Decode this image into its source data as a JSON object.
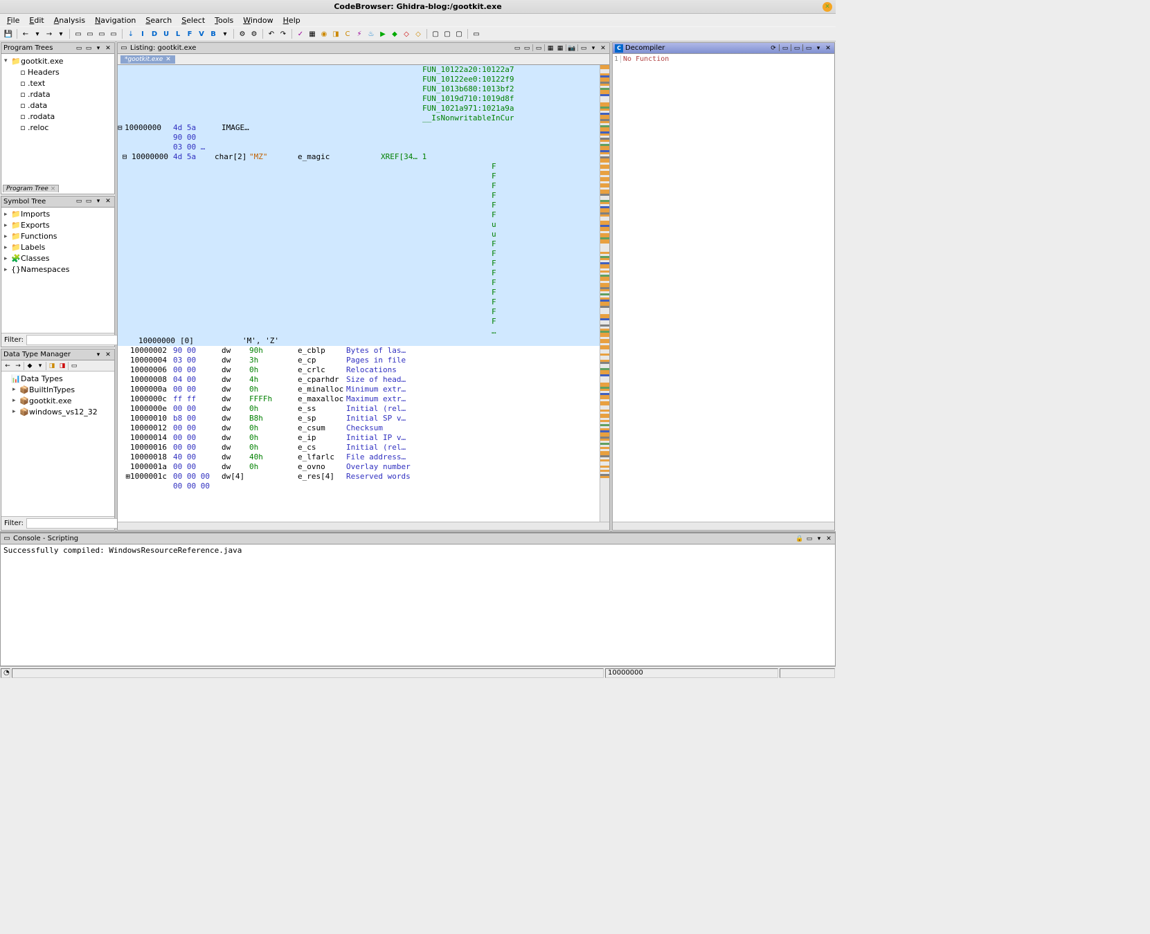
{
  "window": {
    "title": "CodeBrowser: Ghidra-blog:/gootkit.exe"
  },
  "menu": [
    "File",
    "Edit",
    "Analysis",
    "Navigation",
    "Search",
    "Select",
    "Tools",
    "Window",
    "Help"
  ],
  "panels": {
    "program_trees": {
      "title": "Program Trees",
      "root": "gootkit.exe",
      "sections": [
        "Headers",
        ".text",
        ".rdata",
        ".data",
        ".rodata",
        ".reloc"
      ],
      "tab": "Program Tree"
    },
    "symbol_tree": {
      "title": "Symbol Tree",
      "items": [
        "Imports",
        "Exports",
        "Functions",
        "Labels",
        "Classes",
        "Namespaces"
      ],
      "filter_label": "Filter:"
    },
    "dtm": {
      "title": "Data Type Manager",
      "root": "Data Types",
      "items": [
        "BuiltInTypes",
        "gootkit.exe",
        "windows_vs12_32"
      ],
      "filter_label": "Filter:"
    },
    "listing": {
      "title": "Listing: gootkit.exe",
      "tab": "*gootkit.exe",
      "xref_funcs": [
        "FUN_10122a20:10122a7",
        "FUN_10122ee0:10122f9",
        "FUN_1013b680:1013bf2",
        "FUN_1019d710:1019d8f",
        "FUN_1021a971:1021a9a",
        "__IsNonwritableInCur"
      ],
      "header_rows": [
        {
          "addr": "10000000",
          "bytes": "4d 5a",
          "label": "IMAGE…"
        },
        {
          "addr": "",
          "bytes": "90 00",
          "label": ""
        },
        {
          "addr": "",
          "bytes": "03 00 …",
          "label": ""
        }
      ],
      "magic": {
        "addr": "10000000",
        "bytes": "4d 5a",
        "type": "char[2]",
        "val": "\"MZ\"",
        "field": "e_magic",
        "xref": "XREF[34… 1"
      },
      "xref_letters": [
        "F",
        "F",
        "F",
        "F",
        "F",
        "F",
        "u",
        "u",
        "F",
        "F",
        "F",
        "F",
        "F",
        "F",
        "F",
        "F",
        "F",
        "…"
      ],
      "array_row": {
        "addr": "10000000",
        "idx": "[0]",
        "chars": "'M', 'Z'"
      },
      "fields": [
        {
          "addr": "10000002",
          "b": "90 00",
          "t": "dw",
          "v": "90h",
          "f": "e_cblp",
          "c": "Bytes of las…"
        },
        {
          "addr": "10000004",
          "b": "03 00",
          "t": "dw",
          "v": "3h",
          "f": "e_cp",
          "c": "Pages in file"
        },
        {
          "addr": "10000006",
          "b": "00 00",
          "t": "dw",
          "v": "0h",
          "f": "e_crlc",
          "c": "Relocations"
        },
        {
          "addr": "10000008",
          "b": "04 00",
          "t": "dw",
          "v": "4h",
          "f": "e_cparhdr",
          "c": "Size of head…"
        },
        {
          "addr": "1000000a",
          "b": "00 00",
          "t": "dw",
          "v": "0h",
          "f": "e_minalloc",
          "c": "Minimum extr…"
        },
        {
          "addr": "1000000c",
          "b": "ff ff",
          "t": "dw",
          "v": "FFFFh",
          "f": "e_maxalloc",
          "c": "Maximum extr…"
        },
        {
          "addr": "1000000e",
          "b": "00 00",
          "t": "dw",
          "v": "0h",
          "f": "e_ss",
          "c": "Initial (rel…"
        },
        {
          "addr": "10000010",
          "b": "b8 00",
          "t": "dw",
          "v": "B8h",
          "f": "e_sp",
          "c": "Initial SP v…"
        },
        {
          "addr": "10000012",
          "b": "00 00",
          "t": "dw",
          "v": "0h",
          "f": "e_csum",
          "c": "Checksum"
        },
        {
          "addr": "10000014",
          "b": "00 00",
          "t": "dw",
          "v": "0h",
          "f": "e_ip",
          "c": "Initial IP v…"
        },
        {
          "addr": "10000016",
          "b": "00 00",
          "t": "dw",
          "v": "0h",
          "f": "e_cs",
          "c": "Initial (rel…"
        },
        {
          "addr": "10000018",
          "b": "40 00",
          "t": "dw",
          "v": "40h",
          "f": "e_lfarlc",
          "c": "File address…"
        },
        {
          "addr": "1000001a",
          "b": "00 00",
          "t": "dw",
          "v": "0h",
          "f": "e_ovno",
          "c": "Overlay number"
        },
        {
          "addr": "1000001c",
          "b": "00 00 00",
          "t": "dw[4]",
          "v": "",
          "f": "e_res[4]",
          "c": "Reserved words"
        },
        {
          "addr": "",
          "b": "00 00 00",
          "t": "",
          "v": "",
          "f": "",
          "c": ""
        }
      ]
    },
    "decompiler": {
      "title": "Decompiler",
      "line_no": "1",
      "msg": "No Function"
    },
    "console": {
      "title": "Console - Scripting",
      "text": "Successfully compiled: WindowsResourceReference.java"
    }
  },
  "statusbar": {
    "addr": "10000000"
  }
}
